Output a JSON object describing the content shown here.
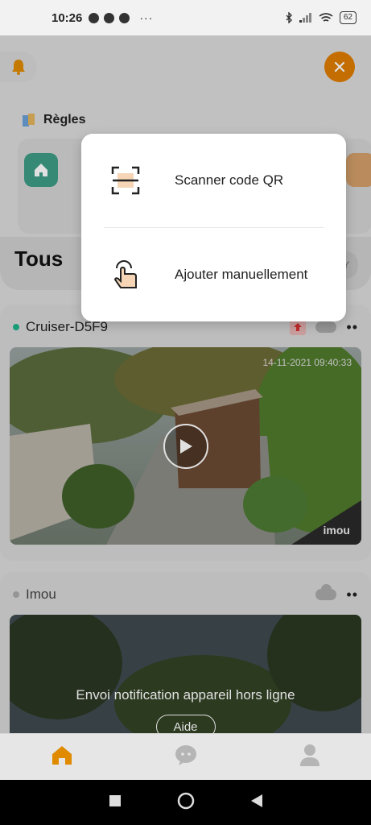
{
  "status_bar": {
    "time": "10:26",
    "dots": "···",
    "battery": "62"
  },
  "rules": {
    "title": "Règles"
  },
  "main": {
    "all_title": "Tous",
    "filter_chip": "Y"
  },
  "popup": {
    "items": [
      {
        "label": "Scanner code QR",
        "icon": "qr-scan-icon"
      },
      {
        "label": "Ajouter manuellement",
        "icon": "hand-tap-icon"
      }
    ]
  },
  "devices": [
    {
      "name": "Cruiser-D5F9",
      "status_color": "#1db38a",
      "timestamp": "14-11-2021 09:40:33",
      "logo": "imou"
    },
    {
      "name": "Imou",
      "status_color": "#aaaaaa",
      "offline_message": "Envoi notification appareil hors ligne",
      "help_label": "Aide"
    }
  ],
  "nav": {
    "items": [
      {
        "icon": "home-icon",
        "active": true
      },
      {
        "icon": "chat-icon",
        "active": false
      },
      {
        "icon": "person-icon",
        "active": false
      }
    ]
  },
  "colors": {
    "accent": "#e07d00",
    "online": "#1db38a",
    "home_tile": "#3d9c86"
  }
}
